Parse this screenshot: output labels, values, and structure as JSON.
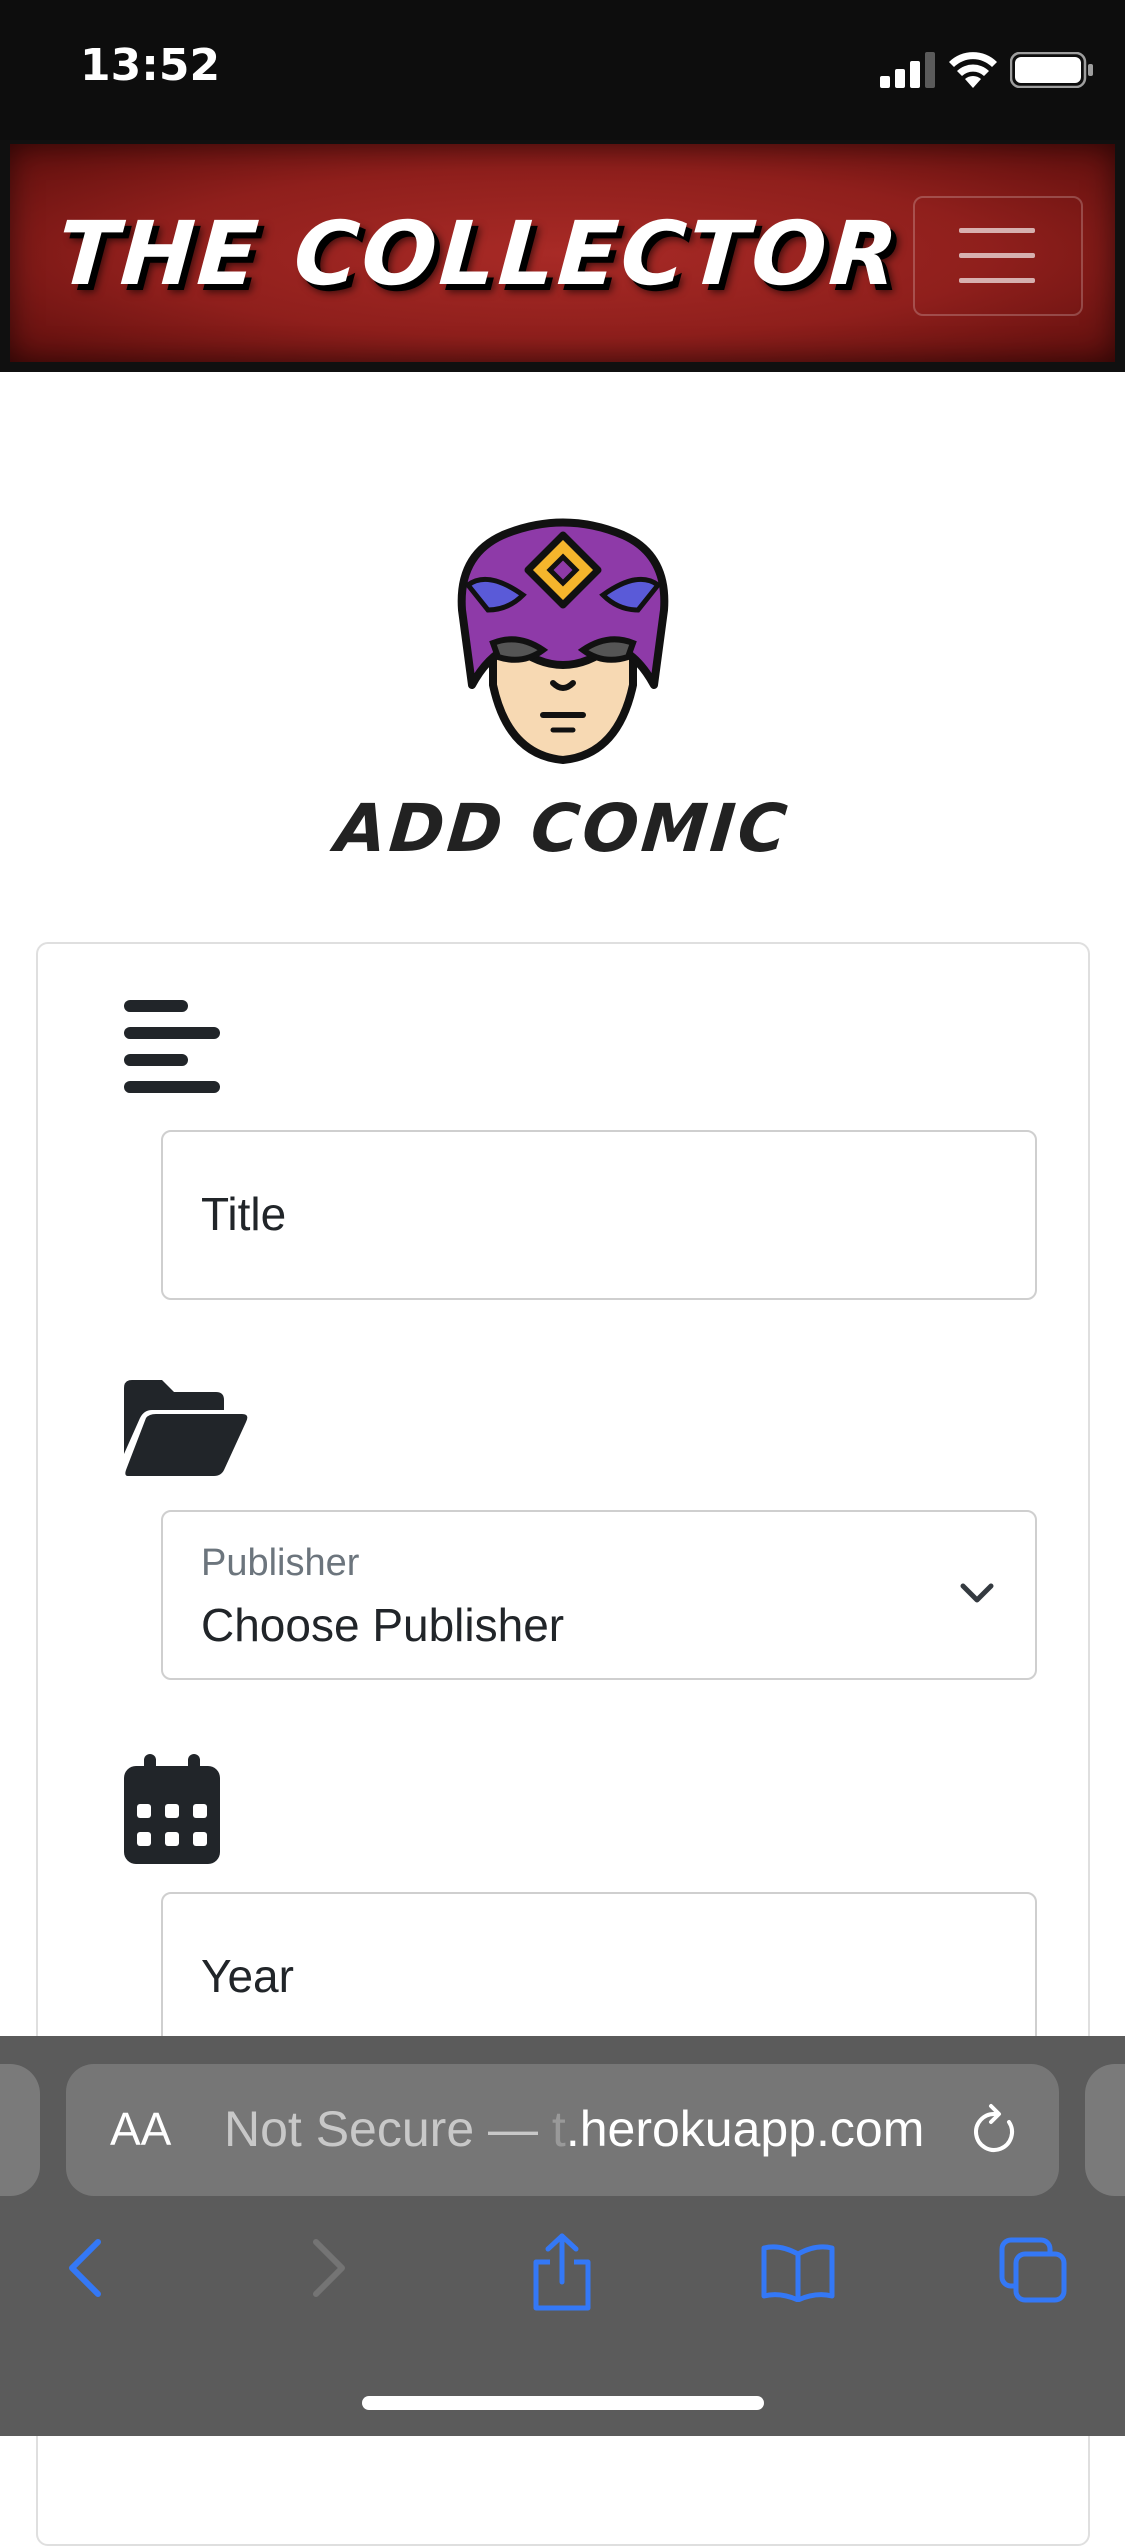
{
  "status_bar": {
    "time": "13:52"
  },
  "navbar": {
    "brand": "THE COLLECTOR",
    "menu_icon": "hamburger-icon"
  },
  "page": {
    "title": "ADD COMIC",
    "hero_icon": "superhero-mask-icon"
  },
  "form": {
    "title_field": {
      "icon": "align-left-icon",
      "placeholder": "Title",
      "value": ""
    },
    "publisher_field": {
      "icon": "folder-open-icon",
      "label": "Publisher",
      "selected": "Choose Publisher"
    },
    "year_field": {
      "icon": "calendar-icon",
      "placeholder": "Year",
      "value": ""
    }
  },
  "browser": {
    "text_size_label": "AA",
    "url_prefix": "Not Secure — ",
    "url_faded": "t",
    "url_host": ".herokuapp.com",
    "icons": [
      "back-icon",
      "forward-icon",
      "share-icon",
      "bookmarks-icon",
      "tabs-icon"
    ]
  },
  "colors": {
    "navbar_red": "#9b2421",
    "ios_blue": "#3478f6",
    "text_dark": "#212529"
  }
}
